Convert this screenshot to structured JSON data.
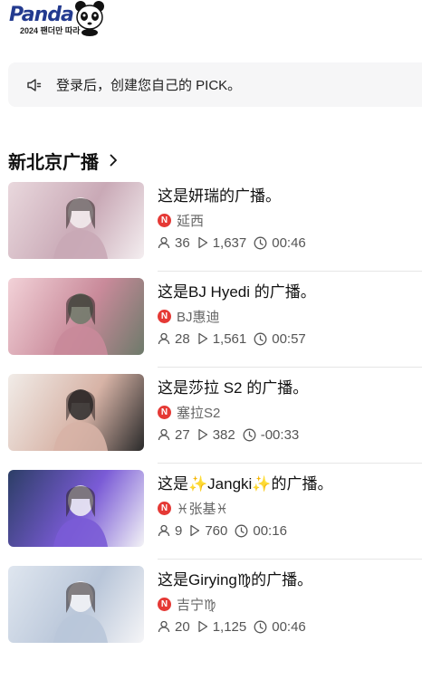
{
  "brand": {
    "logo_text": "Panda",
    "logo_sub": "2024 팬더만 따라"
  },
  "notice": {
    "icon": "speaker-icon",
    "text": "登录后，创建您自己的 PICK。"
  },
  "section": {
    "title": "新北京广播"
  },
  "broadcasts": [
    {
      "title": "这是妍瑞的广播。",
      "badge": "N",
      "streamer": "延西",
      "viewers": "36",
      "plays": "1,637",
      "duration": "00:46",
      "thumb_colors": [
        "#e9d8dd",
        "#c9a9b6",
        "#f4eef0"
      ]
    },
    {
      "title": "这是BJ Hyedi 的广播。",
      "badge": "N",
      "streamer": "BJ惠迪",
      "viewers": "28",
      "plays": "1,561",
      "duration": "00:57",
      "thumb_colors": [
        "#f2d2d8",
        "#c98a9a",
        "#6d7a6a"
      ]
    },
    {
      "title": "这是莎拉 S2 的广播。",
      "badge": "N",
      "streamer": "塞拉S2",
      "viewers": "27",
      "plays": "382",
      "duration": "-00:33",
      "thumb_colors": [
        "#f1ece8",
        "#d7b3a6",
        "#2a2a2a"
      ]
    },
    {
      "title": "这是✨Jangki✨的广播。",
      "badge": "N",
      "streamer": "♓张基♓",
      "viewers": "9",
      "plays": "760",
      "duration": "00:16",
      "thumb_colors": [
        "#2c3e66",
        "#7a5bd6",
        "#f3f3f6"
      ]
    },
    {
      "title": "这是Girying♍的广播。",
      "badge": "N",
      "streamer": "吉宁♍",
      "viewers": "20",
      "plays": "1,125",
      "duration": "00:46",
      "thumb_colors": [
        "#dfe6ef",
        "#b9c6d9",
        "#f5f5f7"
      ]
    }
  ]
}
